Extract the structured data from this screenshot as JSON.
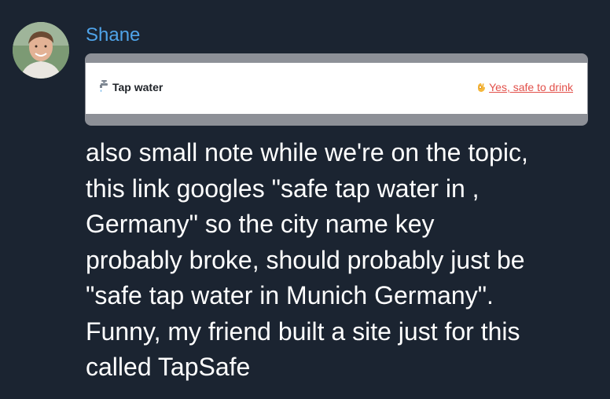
{
  "message": {
    "author": "Shane",
    "avatar_icon": "user-avatar",
    "attachment": {
      "tap_icon": "faucet-icon",
      "label": "Tap water",
      "status_icon": "ok-hand-icon",
      "status_link": "Yes, safe to drink"
    },
    "lines": [
      "also small note while we're on the topic,",
      "this link googles \"safe tap water in  ,",
      "Germany\" so the city name key",
      "probably broke, should probably just be",
      "\"safe tap water in Munich Germany\".",
      "Funny, my friend built a site just for this",
      "called TapSafe"
    ]
  },
  "colors": {
    "background": "#1b2431",
    "author": "#4fa3e8",
    "link": "#e2504a",
    "text": "#ffffff"
  }
}
